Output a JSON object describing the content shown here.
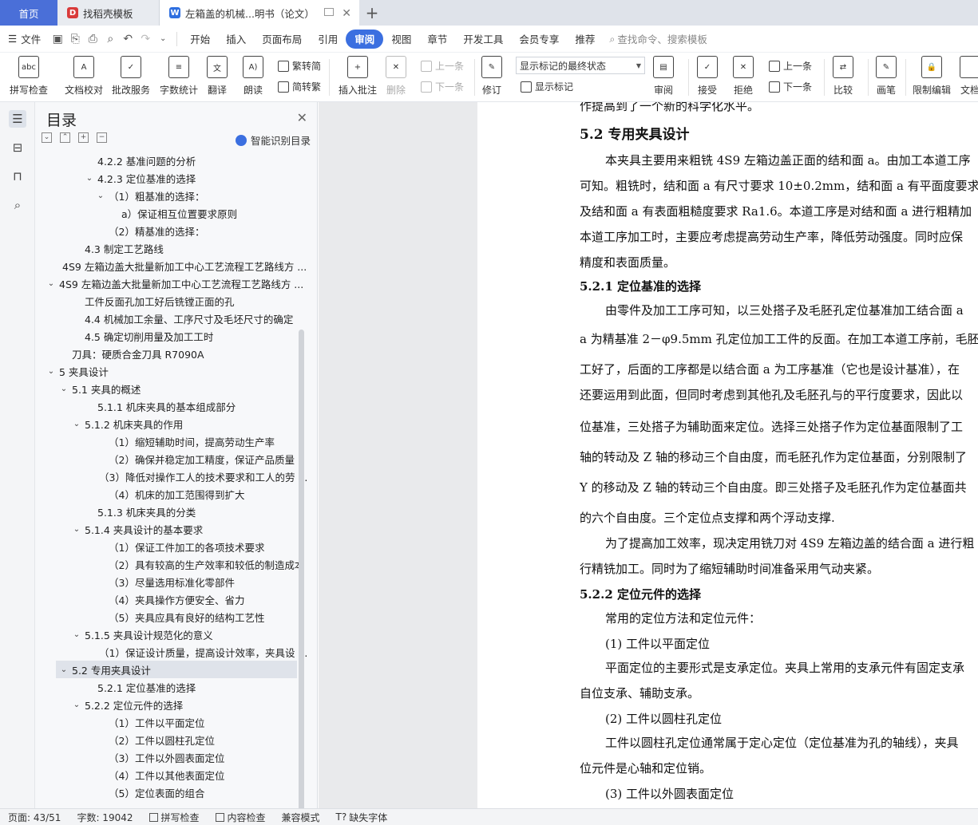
{
  "tabs": {
    "home": "首页",
    "template": "找稻壳模板",
    "doc": "左箱盖的机械...明书（论文）"
  },
  "menu": {
    "file": "文件",
    "items": [
      "开始",
      "插入",
      "页面布局",
      "引用",
      "审阅",
      "视图",
      "章节",
      "开发工具",
      "会员专享",
      "推荐"
    ],
    "active": "审阅",
    "search": "查找命令、搜索模板"
  },
  "ribbon": {
    "spellcheck": "拼写检查",
    "doc_proof": "文档校对",
    "batch_service": "批改服务",
    "word_count": "字数统计",
    "translate": "翻译",
    "read_aloud": "朗读",
    "to_traditional": "繁转简",
    "to_simplified": "简转繁",
    "insert_comment": "插入批注",
    "delete": "删除",
    "prev_item": "上一条",
    "next_item": "下一条",
    "revise": "修订",
    "markup_mode": "显示标记的最终状态",
    "show_markup": "显示标记",
    "review": "审阅",
    "accept": "接受",
    "reject": "拒绝",
    "prev_change": "上一条",
    "next_change": "下一条",
    "compare": "比较",
    "ink": "画笔",
    "restrict_edit": "限制编辑",
    "doc_more": "文档"
  },
  "toc": {
    "title": "目录",
    "smart": "智能识别目录",
    "items": [
      {
        "text": "4.2.2   基准问题的分析",
        "indent": 3,
        "caret": ""
      },
      {
        "text": "4.2.3   定位基准的选择",
        "indent": 3,
        "caret": "v"
      },
      {
        "text": "（1）粗基准的选择：",
        "indent": 4,
        "caret": "v"
      },
      {
        "text": "a）保证相互位置要求原则",
        "indent": 5,
        "caret": ""
      },
      {
        "text": "（2）精基准的选择：",
        "indent": 4,
        "caret": ""
      },
      {
        "text": "4.3   制定工艺路线",
        "indent": 2,
        "caret": ""
      },
      {
        "text": "4S9 左箱边盖大批量新加工中心工艺流程工艺路线方 ...",
        "indent": 1,
        "caret": ""
      },
      {
        "text": "4S9 左箱边盖大批量新加工中心工艺流程工艺路线方 ...",
        "indent": 0,
        "caret": "v"
      },
      {
        "text": "工件反面孔加工好后铣镗正面的孔",
        "indent": 2,
        "caret": ""
      },
      {
        "text": "4.4   机械加工余量、工序尺寸及毛坯尺寸的确定",
        "indent": 2,
        "caret": ""
      },
      {
        "text": "4.5   确定切削用量及加工工时",
        "indent": 2,
        "caret": ""
      },
      {
        "text": "刀具：硬质合金刀具  R7090A",
        "indent": 1,
        "caret": ""
      },
      {
        "text": "5   夹具设计",
        "indent": 0,
        "caret": "v"
      },
      {
        "text": "5.1   夹具的概述",
        "indent": 1,
        "caret": "v"
      },
      {
        "text": "5.1.1   机床夹具的基本组成部分",
        "indent": 3,
        "caret": ""
      },
      {
        "text": "5.1.2   机床夹具的作用",
        "indent": 2,
        "caret": "v"
      },
      {
        "text": "（1）缩短辅助时间，提高劳动生产率",
        "indent": 4,
        "caret": ""
      },
      {
        "text": "（2）确保并稳定加工精度，保证产品质量",
        "indent": 4,
        "caret": ""
      },
      {
        "text": "（3）降低对操作工人的技术要求和工人的劳 ...",
        "indent": 4,
        "caret": ""
      },
      {
        "text": "（4）机床的加工范围得到扩大",
        "indent": 4,
        "caret": ""
      },
      {
        "text": "5.1.3   机床夹具的分类",
        "indent": 3,
        "caret": ""
      },
      {
        "text": "5.1.4   夹具设计的基本要求",
        "indent": 2,
        "caret": "v"
      },
      {
        "text": "（1）保证工件加工的各项技术要求",
        "indent": 4,
        "caret": ""
      },
      {
        "text": "（2）具有较高的生产效率和较低的制造成本",
        "indent": 4,
        "caret": ""
      },
      {
        "text": "（3）尽量选用标准化零部件",
        "indent": 4,
        "caret": ""
      },
      {
        "text": "（4）夹具操作方便安全、省力",
        "indent": 4,
        "caret": ""
      },
      {
        "text": "（5）夹具应具有良好的结构工艺性",
        "indent": 4,
        "caret": ""
      },
      {
        "text": "5.1.5   夹具设计规范化的意义",
        "indent": 2,
        "caret": "v"
      },
      {
        "text": "（1）保证设计质量，提高设计效率，夹具设 ...",
        "indent": 4,
        "caret": ""
      },
      {
        "text": "5.2   专用夹具设计",
        "indent": 1,
        "caret": "v",
        "selected": true
      },
      {
        "text": "5.2.1  定位基准的选择",
        "indent": 3,
        "caret": ""
      },
      {
        "text": "5.2.2   定位元件的选择",
        "indent": 2,
        "caret": "v"
      },
      {
        "text": "（1）工件以平面定位",
        "indent": 4,
        "caret": ""
      },
      {
        "text": "（2）工件以圆柱孔定位",
        "indent": 4,
        "caret": ""
      },
      {
        "text": "（3）工件以外圆表面定位",
        "indent": 4,
        "caret": ""
      },
      {
        "text": "（4）工件以其他表面定位",
        "indent": 4,
        "caret": ""
      },
      {
        "text": "（5）定位表面的组合",
        "indent": 4,
        "caret": ""
      }
    ]
  },
  "document": {
    "lines": [
      {
        "text": "作提高到了一个新的科学化水平。",
        "cls": ""
      },
      {
        "text": "5.2    专用夹具设计",
        "cls": "h2"
      },
      {
        "text": "本夹具主要用来粗铣 4S9 左箱边盖正面的结和面 a。由加工本道工序",
        "cls": "ind"
      },
      {
        "text": "可知。粗铣时，结和面 a 有尺寸要求 10±0.2mm，结和面 a 有平面度要求",
        "cls": ""
      },
      {
        "text": "及结和面 a 有表面粗糙度要求 Ra1.6。本道工序是对结和面 a 进行粗精加",
        "cls": ""
      },
      {
        "text": "本道工序加工时，主要应考虑提高劳动生产率，降低劳动强度。同时应保",
        "cls": ""
      },
      {
        "text": "精度和表面质量。",
        "cls": ""
      },
      {
        "text": "5.2.1      定位基准的选择",
        "cls": "h3"
      },
      {
        "text": "由零件及加工工序可知，以三处搭子及毛胚孔定位基准加工结合面 a",
        "cls": "ind"
      },
      {
        "text": "a 为精基准 2－φ9.5mm 孔定位加工工件的反面。在加工本道工序前，毛胚",
        "cls": ""
      },
      {
        "text": "工好了，后面的工序都是以结合面 a 为工序基准（它也是设计基准），在",
        "cls": ""
      },
      {
        "text": "还要运用到此面，但同时考虑到其他孔及毛胚孔与的平行度要求，因此以",
        "cls": ""
      },
      {
        "text": "位基准，三处搭子为辅助面来定位。选择三处搭子作为定位基面限制了工",
        "cls": ""
      },
      {
        "text": "轴的转动及 Z 轴的移动三个自由度，而毛胚孔作为定位基面，分别限制了",
        "cls": ""
      },
      {
        "text": "Y 的移动及 Z 轴的转动三个自由度。即三处搭子及毛胚孔作为定位基面共",
        "cls": ""
      },
      {
        "text": "的六个自由度。三个定位点支撑和两个浮动支撑.",
        "cls": ""
      },
      {
        "text": "为了提高加工效率，现决定用铣刀对 4S9 左箱边盖的结合面 a 进行粗",
        "cls": "ind"
      },
      {
        "text": "行精铣加工。同时为了缩短辅助时间准备采用气动夹紧。",
        "cls": ""
      },
      {
        "text": "5.2.2    定位元件的选择",
        "cls": "h3"
      },
      {
        "text": "常用的定位方法和定位元件：",
        "cls": "ind"
      },
      {
        "text": "(1)  工件以平面定位",
        "cls": "ind"
      },
      {
        "text": "平面定位的主要形式是支承定位。夹具上常用的支承元件有固定支承",
        "cls": "ind"
      },
      {
        "text": "自位支承、辅助支承。",
        "cls": ""
      },
      {
        "text": "(2)  工件以圆柱孔定位",
        "cls": "ind"
      },
      {
        "text": "工件以圆柱孔定位通常属于定心定位（定位基准为孔的轴线），夹具",
        "cls": "ind"
      },
      {
        "text": "位元件是心轴和定位销。",
        "cls": ""
      },
      {
        "text": "(3)  工件以外圆表面定位",
        "cls": "ind"
      }
    ]
  },
  "status": {
    "page": "页面: 43/51",
    "words": "字数: 19042",
    "spell": "拼写检查",
    "content": "内容检查",
    "compat": "兼容模式",
    "missing_font": "缺失字体"
  },
  "colors": {
    "accent": "#3b6fe0",
    "home_tab": "#4a6fd8"
  }
}
